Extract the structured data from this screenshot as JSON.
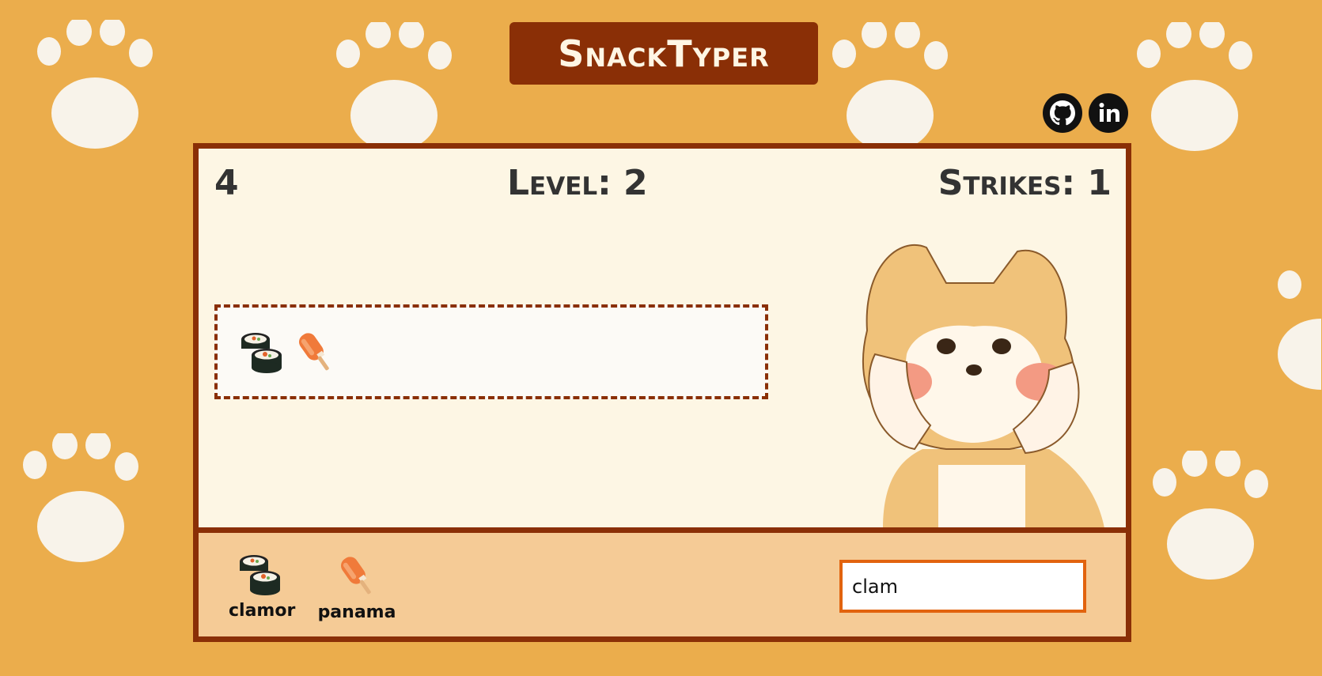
{
  "app": {
    "title": "SnackTyper"
  },
  "links": {
    "github": "github-icon",
    "linkedin": "linkedin-icon"
  },
  "hud": {
    "score": "4",
    "level": "Level: 2",
    "strikes": "Strikes: 1"
  },
  "lane": {
    "snacks": [
      "sushi-roll-icon",
      "popsicle-icon"
    ]
  },
  "tray": {
    "words": [
      {
        "icon": "sushi-roll-icon",
        "word": "clamor"
      },
      {
        "icon": "popsicle-icon",
        "word": "panama"
      }
    ],
    "input_value": "clam"
  },
  "colors": {
    "background": "#ebad4c",
    "board_border": "#8a2f06",
    "board_bg": "#fdf6e4",
    "tray_bg": "#f5cb96",
    "input_border": "#e2630e"
  }
}
